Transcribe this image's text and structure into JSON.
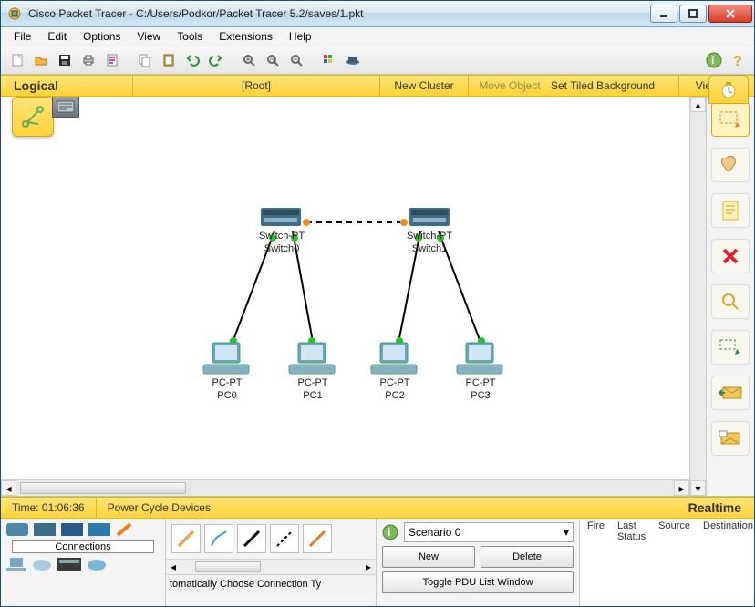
{
  "title": "Cisco Packet Tracer - C:/Users/Podkor/Packet Tracer 5.2/saves/1.pkt",
  "menu": [
    "File",
    "Edit",
    "Options",
    "View",
    "Tools",
    "Extensions",
    "Help"
  ],
  "yellowbar": {
    "logical": "Logical",
    "root": "[Root]",
    "newcluster": "New Cluster",
    "move": "Move Object",
    "tiled": "Set Tiled Background",
    "viewport": "Viewport"
  },
  "devices": {
    "sw0": {
      "type": "Switch-PT",
      "name": "Switch0"
    },
    "sw1": {
      "type": "Switch-PT",
      "name": "Switch1"
    },
    "pc0": {
      "type": "PC-PT",
      "name": "PC0"
    },
    "pc1": {
      "type": "PC-PT",
      "name": "PC1"
    },
    "pc2": {
      "type": "PC-PT",
      "name": "PC2"
    },
    "pc3": {
      "type": "PC-PT",
      "name": "PC3"
    }
  },
  "timebar": {
    "time": "Time: 01:06:36",
    "power": "Power Cycle Devices",
    "realtime": "Realtime"
  },
  "bottom": {
    "connections_label": "Connections",
    "scenario": "Scenario 0",
    "new": "New",
    "delete": "Delete",
    "toggle": "Toggle PDU List Window",
    "status_text": "tomatically Choose Connection Ty"
  },
  "events": {
    "cols": [
      "Fire",
      "Last Status",
      "Source",
      "Destination"
    ]
  }
}
